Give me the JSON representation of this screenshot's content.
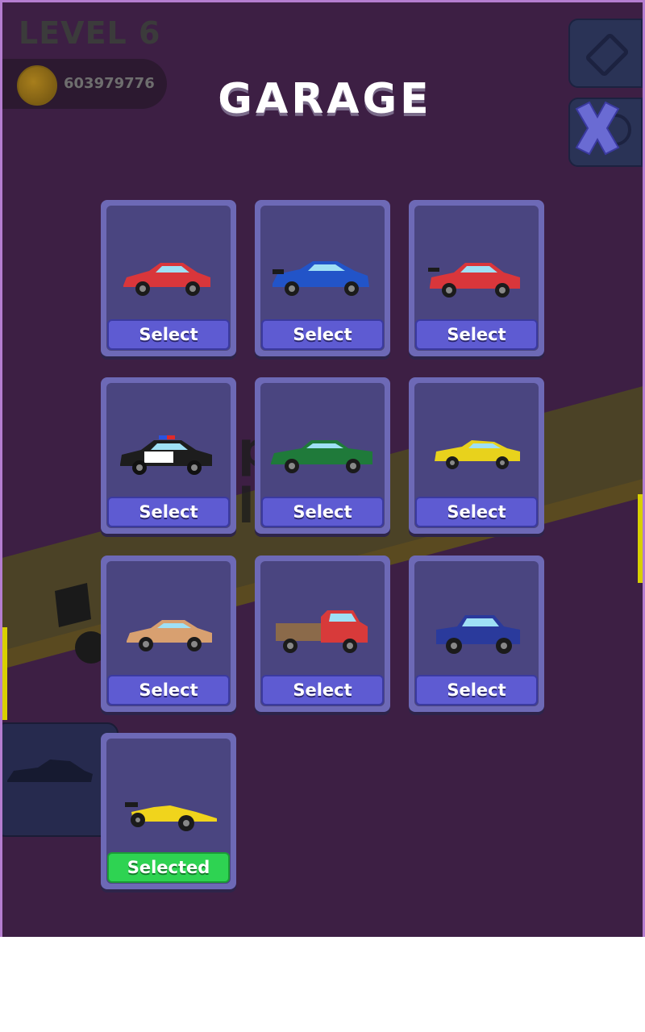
{
  "hud": {
    "level": "LEVEL 6",
    "coins": "603979776"
  },
  "title": "GARAGE",
  "background_text": "p l",
  "cars": [
    {
      "id": "red-coupe",
      "button": "Select",
      "selected": false,
      "color": "#d9363b"
    },
    {
      "id": "blue-supercar",
      "button": "Select",
      "selected": false,
      "color": "#2254c8"
    },
    {
      "id": "red-sedan",
      "button": "Select",
      "selected": false,
      "color": "#d9363b"
    },
    {
      "id": "police-car",
      "button": "Select",
      "selected": false,
      "color": "#1d1d1d"
    },
    {
      "id": "green-muscle",
      "button": "Select",
      "selected": false,
      "color": "#1f7a3a"
    },
    {
      "id": "yellow-sports",
      "button": "Select",
      "selected": false,
      "color": "#e8d21c"
    },
    {
      "id": "orange-coupe",
      "button": "Select",
      "selected": false,
      "color": "#d8a070"
    },
    {
      "id": "red-truck",
      "button": "Select",
      "selected": false,
      "color": "#d83a3a"
    },
    {
      "id": "blue-pickup",
      "button": "Select",
      "selected": false,
      "color": "#2a3a9c"
    },
    {
      "id": "yellow-f1",
      "button": "Selected",
      "selected": true,
      "color": "#f0d41c"
    }
  ]
}
